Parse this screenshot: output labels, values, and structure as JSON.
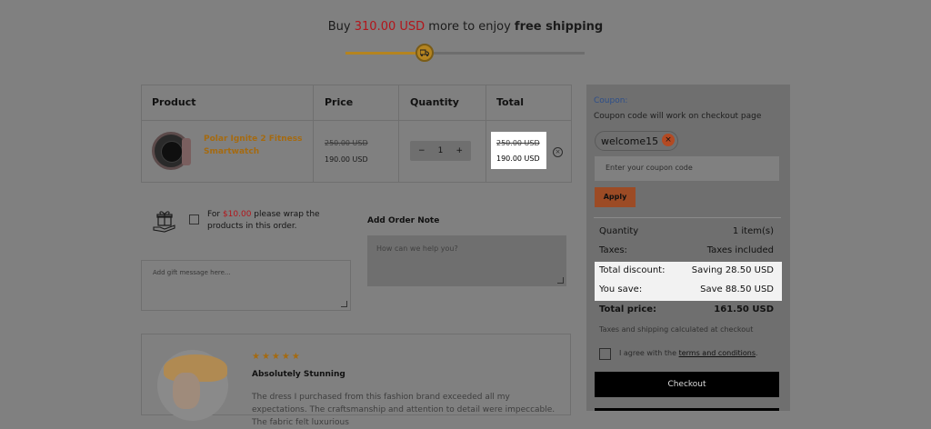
{
  "shipping": {
    "prefix": "Buy ",
    "amount": "310.00 USD",
    "middle": " more to enjoy ",
    "bold": "free shipping"
  },
  "table": {
    "headers": [
      "Product",
      "Price",
      "Quantity",
      "Total"
    ],
    "item": {
      "name": "Polar Ignite 2 Fitness Smartwatch",
      "old_price": "250.00 USD",
      "price": "190.00 USD",
      "quantity": "1",
      "minus": "−",
      "plus": "+",
      "total_old": "250.00 USD",
      "total": "190.00 USD",
      "remove_glyph": "×"
    }
  },
  "gift": {
    "text_prefix": "For ",
    "amount": "$10.00",
    "text_suffix": " please wrap the products in this order.",
    "message_placeholder": "Add gift message here..."
  },
  "order_note": {
    "title": "Add Order Note",
    "placeholder": "How can we help you?"
  },
  "review": {
    "stars": "★★★★★",
    "title": "Absolutely Stunning",
    "body": "The dress I purchased from this fashion brand exceeded all my expectations. The craftsmanship and attention to detail were impeccable. The fabric felt luxurious"
  },
  "coupon": {
    "label": "Coupon:",
    "hint": "Coupon code will work on checkout page",
    "applied_code": "welcome15",
    "remove_glyph": "×",
    "input_placeholder": "Enter your coupon code",
    "apply_label": "Apply"
  },
  "summary": {
    "quantity_label": "Quantity",
    "quantity_value": "1 item(s)",
    "taxes_label": "Taxes:",
    "taxes_value": "Taxes included",
    "discount_label": "Total discount:",
    "discount_value": "Saving 28.50 USD",
    "save_label": "You save:",
    "save_value": "Save 88.50 USD",
    "total_label": "Total price:",
    "total_value": "161.50 USD",
    "tax_note": "Taxes and shipping calculated at checkout",
    "agree_prefix": "I agree with the ",
    "agree_link": "terms and conditions",
    "agree_suffix": ".",
    "checkout_label": "Checkout"
  },
  "colors": {
    "overlay": "#808080",
    "accent_red": "#b2151b",
    "accent_gold": "#a56a10",
    "apply_orange": "#9c4b25",
    "highlight": "#ffffff"
  },
  "progress": {
    "shipping_fraction": 0.33
  }
}
